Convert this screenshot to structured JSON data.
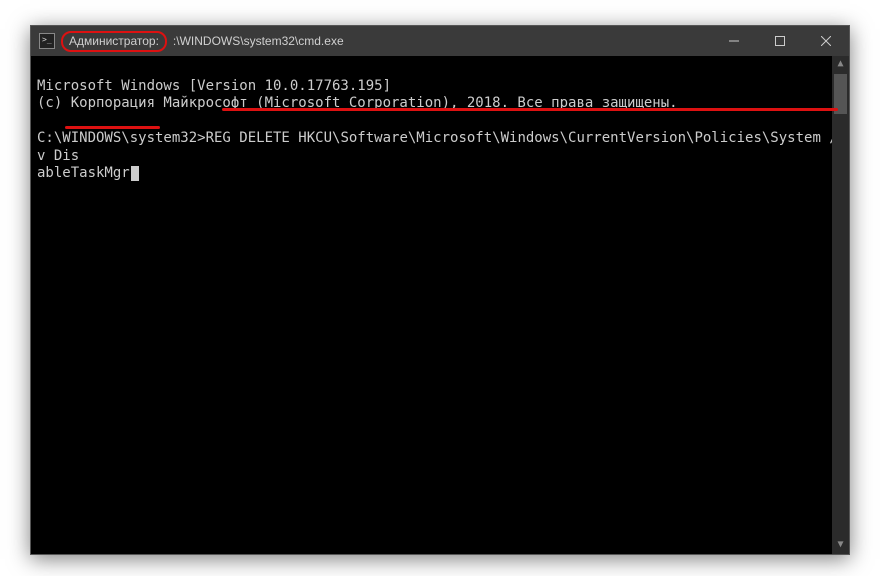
{
  "titlebar": {
    "admin_label": "Администратор:",
    "path_label": ":\\WINDOWS\\system32\\cmd.exe"
  },
  "terminal": {
    "line1": "Microsoft Windows [Version 10.0.17763.195]",
    "line2": "(c) Корпорация Майкрософт (Microsoft Corporation), 2018. Все права защищены.",
    "blank": "",
    "prompt": "C:\\WINDOWS\\system32>",
    "command_part1": "REG DELETE HKCU\\Software\\Microsoft\\Windows\\CurrentVersion\\Policies\\System /v Dis",
    "command_part2": "ableTaskMgr"
  },
  "annotations": {
    "underline_color": "#d11"
  }
}
